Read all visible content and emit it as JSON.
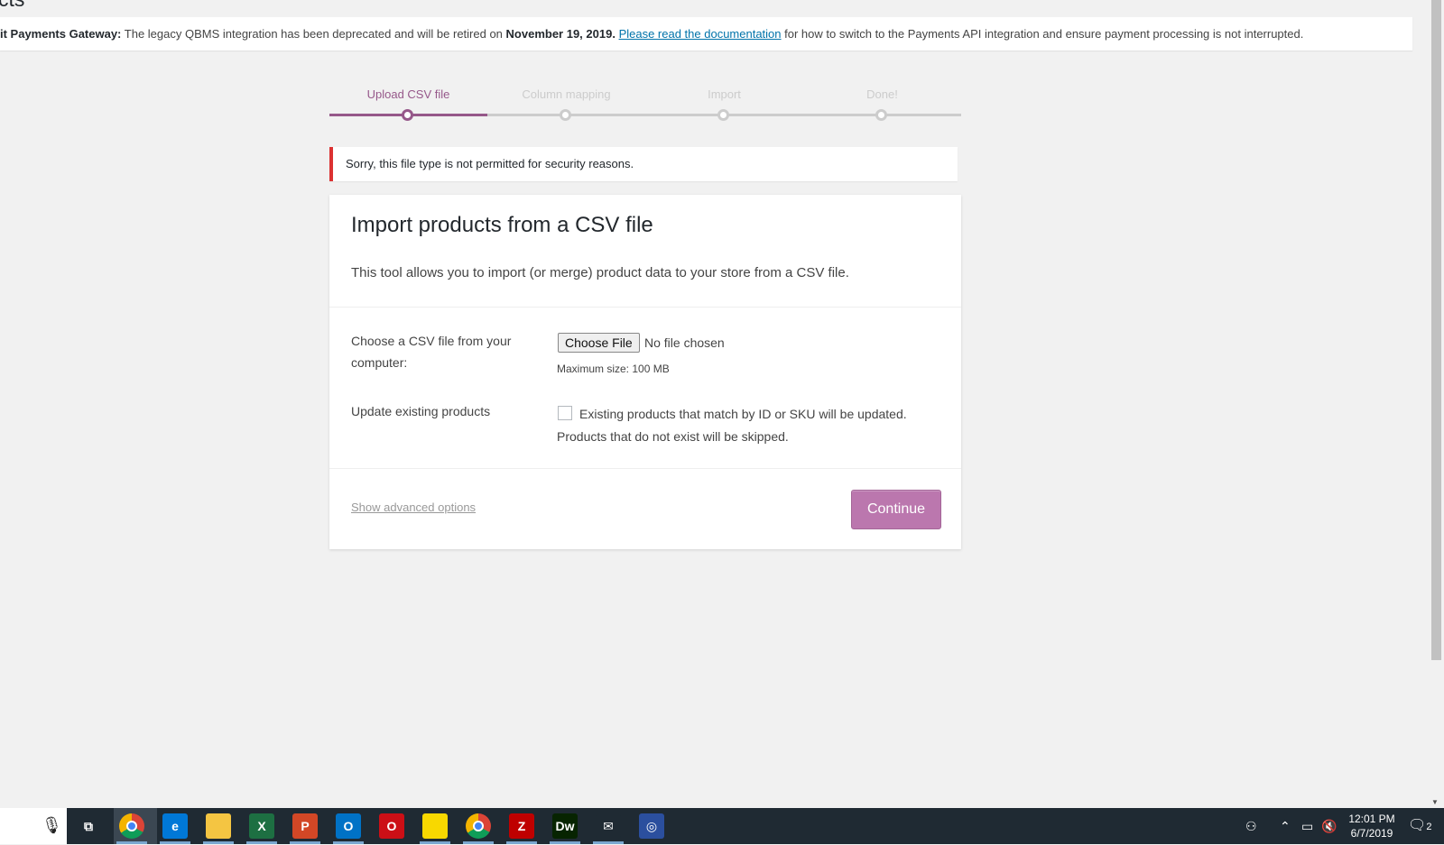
{
  "page": {
    "title": "cts"
  },
  "notice": {
    "strong_prefix": "it Payments Gateway:",
    "text_before": " The legacy QBMS integration has been deprecated and will be retired on ",
    "date": "November 19, 2019.",
    "link": "Please read the documentation",
    "text_after": " for how to switch to the Payments API integration and ensure payment processing is not interrupted."
  },
  "steps": [
    {
      "label": "Upload CSV file",
      "active": true
    },
    {
      "label": "Column mapping",
      "active": false
    },
    {
      "label": "Import",
      "active": false
    },
    {
      "label": "Done!",
      "active": false
    }
  ],
  "steps_progress": 0.25,
  "error": {
    "message": "Sorry, this file type is not permitted for security reasons."
  },
  "form": {
    "title": "Import products from a CSV file",
    "description": "This tool allows you to import (or merge) product data to your store from a CSV file.",
    "file_label": "Choose a CSV file from your computer:",
    "file_button": "Choose File",
    "file_status": "No file chosen",
    "max_size": "Maximum size: 100 MB",
    "update_label": "Update existing products",
    "update_description": "Existing products that match by ID or SKU will be updated. Products that do not exist will be skipped.",
    "update_checked": false,
    "advanced_link": "Show advanced options",
    "continue_button": "Continue"
  },
  "colors": {
    "accent": "#96588a",
    "button": "#bb77ae",
    "error": "#dc3232",
    "link": "#0073aa"
  },
  "taskbar": {
    "apps": [
      {
        "name": "task-view-icon",
        "glyph": "⧉"
      },
      {
        "name": "chrome-icon",
        "glyph": "",
        "color": "#e8453c"
      },
      {
        "name": "edge-icon",
        "glyph": "e",
        "color": "#0078d7"
      },
      {
        "name": "file-explorer-icon",
        "glyph": "",
        "color": "#f4c542"
      },
      {
        "name": "excel-icon",
        "glyph": "X",
        "color": "#1d6f42"
      },
      {
        "name": "powerpoint-icon",
        "glyph": "P",
        "color": "#d24726"
      },
      {
        "name": "outlook-icon",
        "glyph": "O",
        "color": "#0072c6"
      },
      {
        "name": "opera-icon",
        "glyph": "O",
        "color": "#cc0f16"
      },
      {
        "name": "sticky-notes-icon",
        "glyph": "",
        "color": "#f8d800"
      },
      {
        "name": "chrome-2-icon",
        "glyph": "",
        "color": "#e8453c"
      },
      {
        "name": "filezilla-icon",
        "glyph": "Z",
        "color": "#bf0000"
      },
      {
        "name": "dreamweaver-icon",
        "glyph": "Dw",
        "color": "#072401"
      },
      {
        "name": "mail-icon",
        "glyph": "✉",
        "color": "#1f2a33"
      },
      {
        "name": "app-circle-icon",
        "glyph": "◎",
        "color": "#2b4f9e"
      }
    ],
    "clock": {
      "time": "12:01 PM",
      "date": "6/7/2019"
    },
    "notification_count": "2"
  }
}
